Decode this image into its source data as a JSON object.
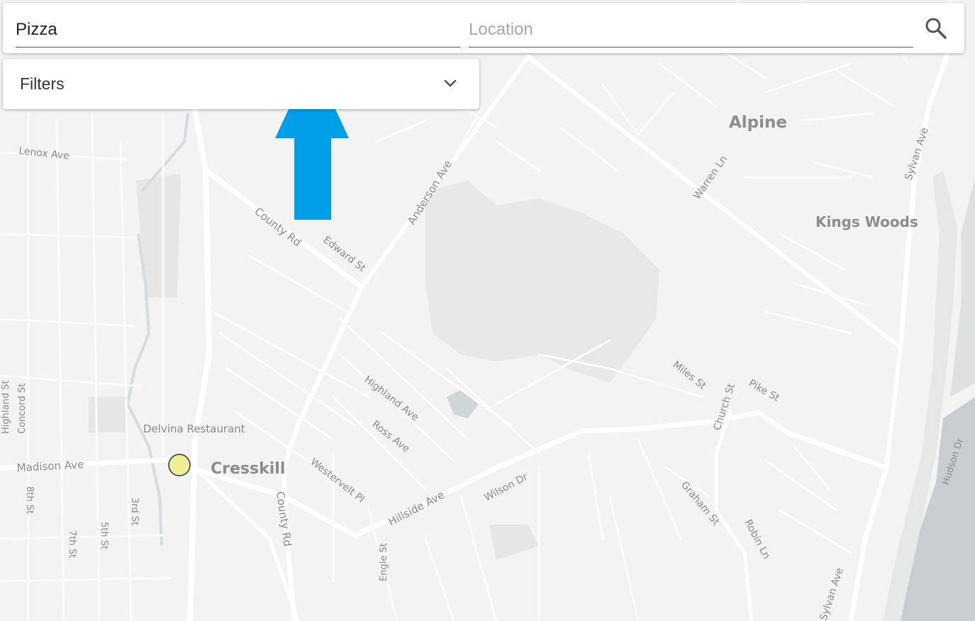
{
  "search": {
    "query_value": "Pizza",
    "location_placeholder": "Location",
    "button_icon": "search-icon"
  },
  "filters": {
    "label": "Filters",
    "icon": "chevron-down-icon"
  },
  "map": {
    "places": {
      "alpine": "Alpine",
      "kings_woods": "Kings Woods",
      "cresskill": "Cresskill"
    },
    "poi": {
      "name": "Delvina Restaurant",
      "marker_color": "#eeee99"
    },
    "streets": {
      "lenox_ave": "Lenox Ave",
      "county_rd_north": "County Rd",
      "edward_st": "Edward St",
      "anderson_ave": "Anderson Ave",
      "warren_ln": "Warren Ln",
      "sylvan_ave_north": "Sylvan Ave",
      "highland_ave": "Highland Ave",
      "ross_ave": "Ross Ave",
      "westervelt_pl": "Westervelt Pl",
      "hillside_ave": "Hillside Ave",
      "wilson_dr": "Wilson Dr",
      "miles_st": "Miles St",
      "church_st": "Church St",
      "pike_st": "Pike St",
      "graham_st": "Graham St",
      "robin_ln": "Robin Ln",
      "hudson_dr": "Hudson Dr",
      "sylvan_ave_south": "Sylvan Ave",
      "madison_ave": "Madison Ave",
      "highland_st": "Highland St",
      "concord_st": "Concord St",
      "eighth_st": "8th St",
      "seventh_st": "7th St",
      "fifth_st": "5th St",
      "third_st": "3rd St",
      "county_rd_south": "County Rd",
      "engle_st": "Engle St"
    },
    "annotation_arrow_color": "#009fe8"
  }
}
